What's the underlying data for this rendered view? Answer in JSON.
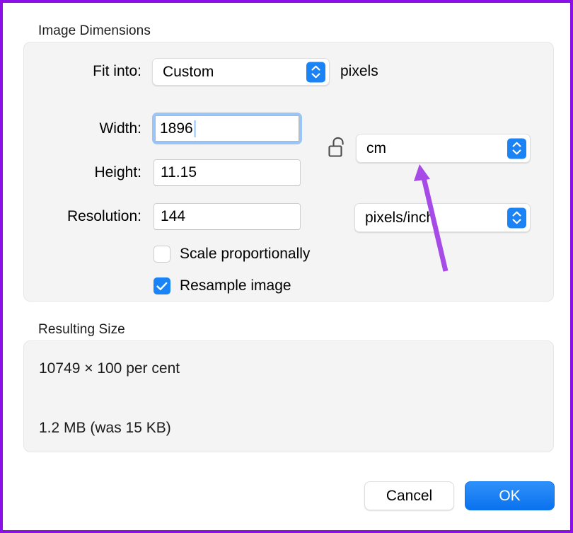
{
  "window": {
    "highlight_border_color": "#8B10E8"
  },
  "sections": {
    "image_dimensions": {
      "title": "Image Dimensions",
      "fit_into": {
        "label": "Fit into:",
        "value": "Custom",
        "unit_suffix": "pixels"
      },
      "width": {
        "label": "Width:",
        "value": "1896",
        "focused": true
      },
      "height": {
        "label": "Height:",
        "value": "11.15"
      },
      "resolution": {
        "label": "Resolution:",
        "value": "144"
      },
      "size_unit": {
        "value": "cm",
        "lock_icon": "unlocked-padlock-icon"
      },
      "resolution_unit": {
        "value": "pixels/inch"
      },
      "scale_proportionally": {
        "label": "Scale proportionally",
        "checked": false
      },
      "resample_image": {
        "label": "Resample image",
        "checked": true
      }
    },
    "resulting_size": {
      "title": "Resulting Size",
      "line1": "10749 × 100 per cent",
      "line2": "1.2 MB (was 15 KB)"
    }
  },
  "footer": {
    "cancel_label": "Cancel",
    "ok_label": "OK"
  },
  "annotation": {
    "arrow_color": "#A64BE8",
    "points_to": "cm"
  },
  "theme": {
    "accent_blue": "#1a83f5",
    "panel_bg": "#f4f4f4",
    "focus_ring": "#9cc5f7"
  }
}
